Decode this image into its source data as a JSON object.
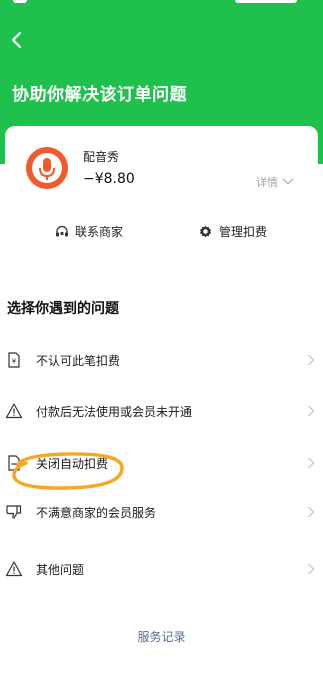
{
  "colors": {
    "brand_green": "#1fc14c",
    "link_blue": "#576b95",
    "annotation_orange": "#f7a823"
  },
  "header": {
    "title": "协助你解决该订单问题",
    "back_icon": "chevron-left-icon"
  },
  "order": {
    "merchant_name": "配音秀",
    "amount": "−¥8.80",
    "detail_label": "详情",
    "actions": [
      {
        "label": "联系商家",
        "icon": "headset-icon"
      },
      {
        "label": "管理扣费",
        "icon": "gear-icon"
      }
    ]
  },
  "issues": {
    "title": "选择你遇到的问题",
    "items": [
      {
        "label": "不认可此笔扣费",
        "icon": "yuan-doc-icon"
      },
      {
        "label": "付款后无法使用或会员未开通",
        "icon": "warning-icon"
      },
      {
        "label": "关闭自动扣费",
        "icon": "doc-icon"
      },
      {
        "label": "不满意商家的会员服务",
        "icon": "thumbs-down-icon"
      },
      {
        "label": "其他问题",
        "icon": "warning-icon"
      }
    ]
  },
  "footer": {
    "service_record": "服务记录"
  }
}
